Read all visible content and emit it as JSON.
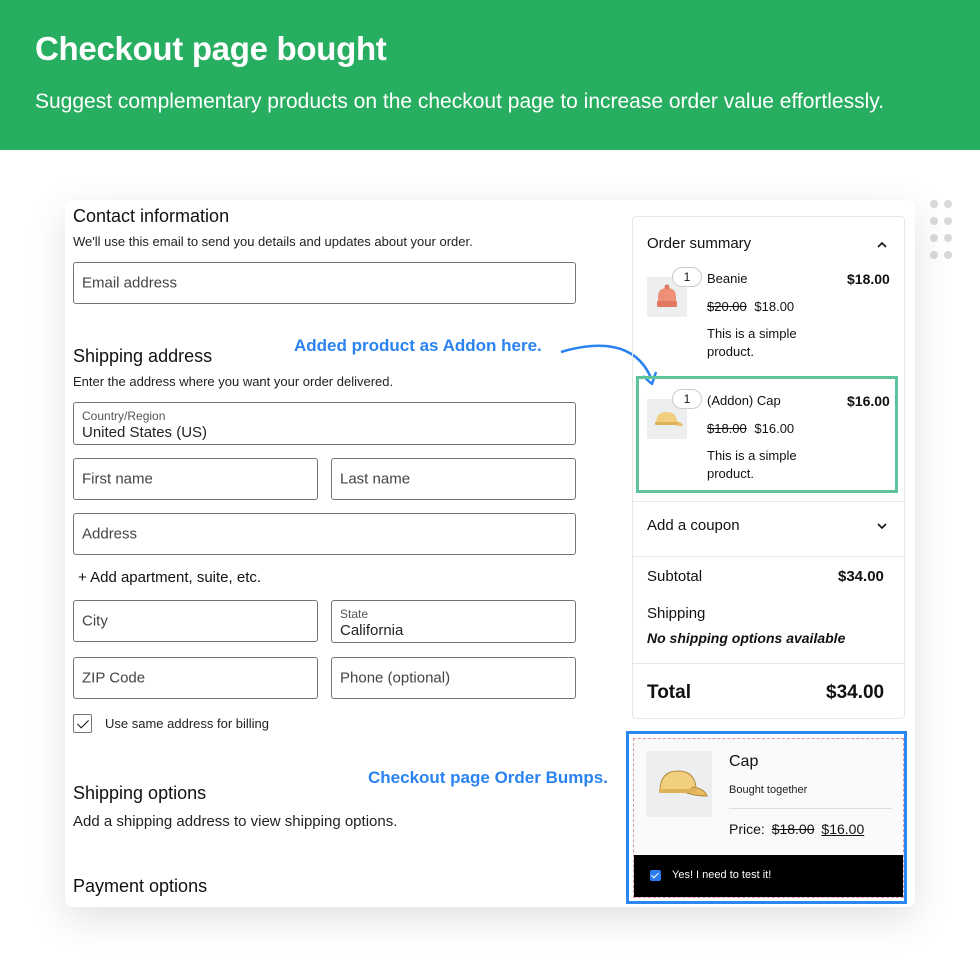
{
  "banner": {
    "title": "Checkout page bought",
    "subtitle": "Suggest complementary products on the checkout page to increase order value effortlessly."
  },
  "contact": {
    "heading": "Contact information",
    "description": "We'll use this email to send you details and updates about your order.",
    "email_placeholder": "Email address"
  },
  "shipping_address": {
    "heading": "Shipping address",
    "description": "Enter the address where you want your order delivered.",
    "country_label": "Country/Region",
    "country_value": "United States (US)",
    "first_name_placeholder": "First name",
    "last_name_placeholder": "Last name",
    "address_placeholder": "Address",
    "add_apartment_link": "+ Add apartment, suite, etc.",
    "city_placeholder": "City",
    "state_label": "State",
    "state_value": "California",
    "zip_placeholder": "ZIP Code",
    "phone_placeholder": "Phone (optional)",
    "same_billing_label": "Use same address for billing",
    "same_billing_checked": true
  },
  "shipping_options": {
    "heading": "Shipping options",
    "description": "Add a shipping address to view shipping options."
  },
  "payment_options": {
    "heading": "Payment options"
  },
  "order_summary": {
    "heading": "Order summary",
    "items": [
      {
        "qty": "1",
        "name": "Beanie",
        "line_total": "$18.00",
        "regular_price": "$20.00",
        "sale_price": "$18.00",
        "description_line1": "This is a simple",
        "description_line2": "product.",
        "icon": "beanie-image"
      },
      {
        "qty": "1",
        "name": "(Addon) Cap",
        "line_total": "$16.00",
        "regular_price": "$18.00",
        "sale_price": "$16.00",
        "description_line1": "This is a simple",
        "description_line2": "product.",
        "icon": "cap-image"
      }
    ],
    "coupon_label": "Add a coupon",
    "subtotal_label": "Subtotal",
    "subtotal_value": "$34.00",
    "shipping_label": "Shipping",
    "shipping_note": "No shipping options available",
    "total_label": "Total",
    "total_value": "$34.00"
  },
  "order_bump": {
    "title": "Cap",
    "subtitle": "Bought together",
    "price_label": "Price:",
    "regular_price": "$18.00",
    "sale_price": "$16.00",
    "checkbox_label": "Yes! I need to test it!",
    "checked": true
  },
  "annotations": {
    "addon": "Added product as Addon here.",
    "bumps": "Checkout page Order Bumps."
  },
  "colors": {
    "banner": "#27ae60",
    "addon_highlight": "#5cc39a",
    "bump_highlight": "#2b88f0",
    "annotation_text": "#2a83f0"
  }
}
